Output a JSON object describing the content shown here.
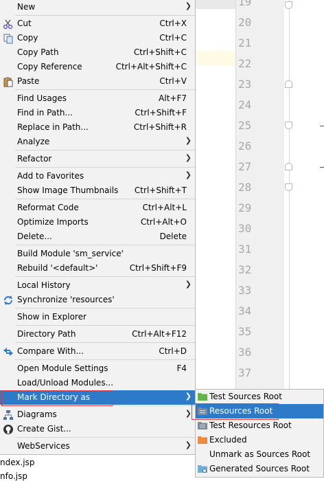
{
  "editor": {
    "line_numbers": [
      "19",
      "20",
      "21",
      "22",
      "23",
      "24",
      "25",
      "26",
      "27",
      "28",
      "29",
      "30",
      "31",
      "32",
      "33",
      "34",
      "35",
      "36",
      "37"
    ]
  },
  "project_tree": {
    "files": [
      "ndex.jsp",
      "nfo.jsp"
    ]
  },
  "context_menu": {
    "items": [
      {
        "label": "New",
        "shortcut": "",
        "submenu": true,
        "icon": ""
      },
      {
        "label": "Cut",
        "shortcut": "Ctrl+X",
        "submenu": false,
        "icon": "scissors-icon"
      },
      {
        "label": "Copy",
        "shortcut": "Ctrl+C",
        "submenu": false,
        "icon": "copy-icon"
      },
      {
        "label": "Copy Path",
        "shortcut": "Ctrl+Shift+C",
        "submenu": false,
        "icon": ""
      },
      {
        "label": "Copy Reference",
        "shortcut": "Ctrl+Alt+Shift+C",
        "submenu": false,
        "icon": ""
      },
      {
        "label": "Paste",
        "shortcut": "Ctrl+V",
        "submenu": false,
        "icon": "paste-icon"
      },
      {
        "label": "Find Usages",
        "shortcut": "Alt+F7",
        "submenu": false,
        "icon": ""
      },
      {
        "label": "Find in Path...",
        "shortcut": "Ctrl+Shift+F",
        "submenu": false,
        "icon": ""
      },
      {
        "label": "Replace in Path...",
        "shortcut": "Ctrl+Shift+R",
        "submenu": false,
        "icon": ""
      },
      {
        "label": "Analyze",
        "shortcut": "",
        "submenu": true,
        "icon": ""
      },
      {
        "label": "Refactor",
        "shortcut": "",
        "submenu": true,
        "icon": ""
      },
      {
        "label": "Add to Favorites",
        "shortcut": "",
        "submenu": true,
        "icon": ""
      },
      {
        "label": "Show Image Thumbnails",
        "shortcut": "Ctrl+Shift+T",
        "submenu": false,
        "icon": ""
      },
      {
        "label": "Reformat Code",
        "shortcut": "Ctrl+Alt+L",
        "submenu": false,
        "icon": ""
      },
      {
        "label": "Optimize Imports",
        "shortcut": "Ctrl+Alt+O",
        "submenu": false,
        "icon": ""
      },
      {
        "label": "Delete...",
        "shortcut": "Delete",
        "submenu": false,
        "icon": ""
      },
      {
        "label": "Build Module 'sm_service'",
        "shortcut": "",
        "submenu": false,
        "icon": ""
      },
      {
        "label": "Rebuild '<default>'",
        "shortcut": "Ctrl+Shift+F9",
        "submenu": false,
        "icon": ""
      },
      {
        "label": "Local History",
        "shortcut": "",
        "submenu": true,
        "icon": ""
      },
      {
        "label": "Synchronize 'resources'",
        "shortcut": "",
        "submenu": false,
        "icon": "sync-icon"
      },
      {
        "label": "Show in Explorer",
        "shortcut": "",
        "submenu": false,
        "icon": ""
      },
      {
        "label": "Directory Path",
        "shortcut": "Ctrl+Alt+F12",
        "submenu": false,
        "icon": ""
      },
      {
        "label": "Compare With...",
        "shortcut": "Ctrl+D",
        "submenu": false,
        "icon": "compare-icon"
      },
      {
        "label": "Open Module Settings",
        "shortcut": "F4",
        "submenu": false,
        "icon": ""
      },
      {
        "label": "Load/Unload Modules...",
        "shortcut": "",
        "submenu": false,
        "icon": ""
      },
      {
        "label": "Mark Directory as",
        "shortcut": "",
        "submenu": true,
        "icon": "",
        "selected": true
      },
      {
        "label": "Diagrams",
        "shortcut": "",
        "submenu": true,
        "icon": "diagram-icon"
      },
      {
        "label": "Create Gist...",
        "shortcut": "",
        "submenu": false,
        "icon": "github-icon"
      },
      {
        "label": "WebServices",
        "shortcut": "",
        "submenu": true,
        "icon": ""
      }
    ]
  },
  "mark_directory_submenu": {
    "items": [
      {
        "label": "Test Sources Root",
        "icon": "test-sources-folder-icon",
        "color": "#62b543"
      },
      {
        "label": "Resources Root",
        "icon": "resources-folder-icon",
        "color": "#7e8a9a",
        "selected": true
      },
      {
        "label": "Test Resources Root",
        "icon": "test-resources-folder-icon",
        "color": "#7e8a9a"
      },
      {
        "label": "Excluded",
        "icon": "excluded-folder-icon",
        "color": "#f08a3c"
      },
      {
        "label": "Unmark as Sources Root",
        "icon": "",
        "color": ""
      },
      {
        "label": "Generated Sources Root",
        "icon": "generated-sources-folder-icon",
        "color": "#6fb0d8"
      }
    ]
  },
  "colors": {
    "selection": "#2d7bc8",
    "highlight_box": "#e23a3a",
    "menu_bg": "#f2f2f2"
  }
}
